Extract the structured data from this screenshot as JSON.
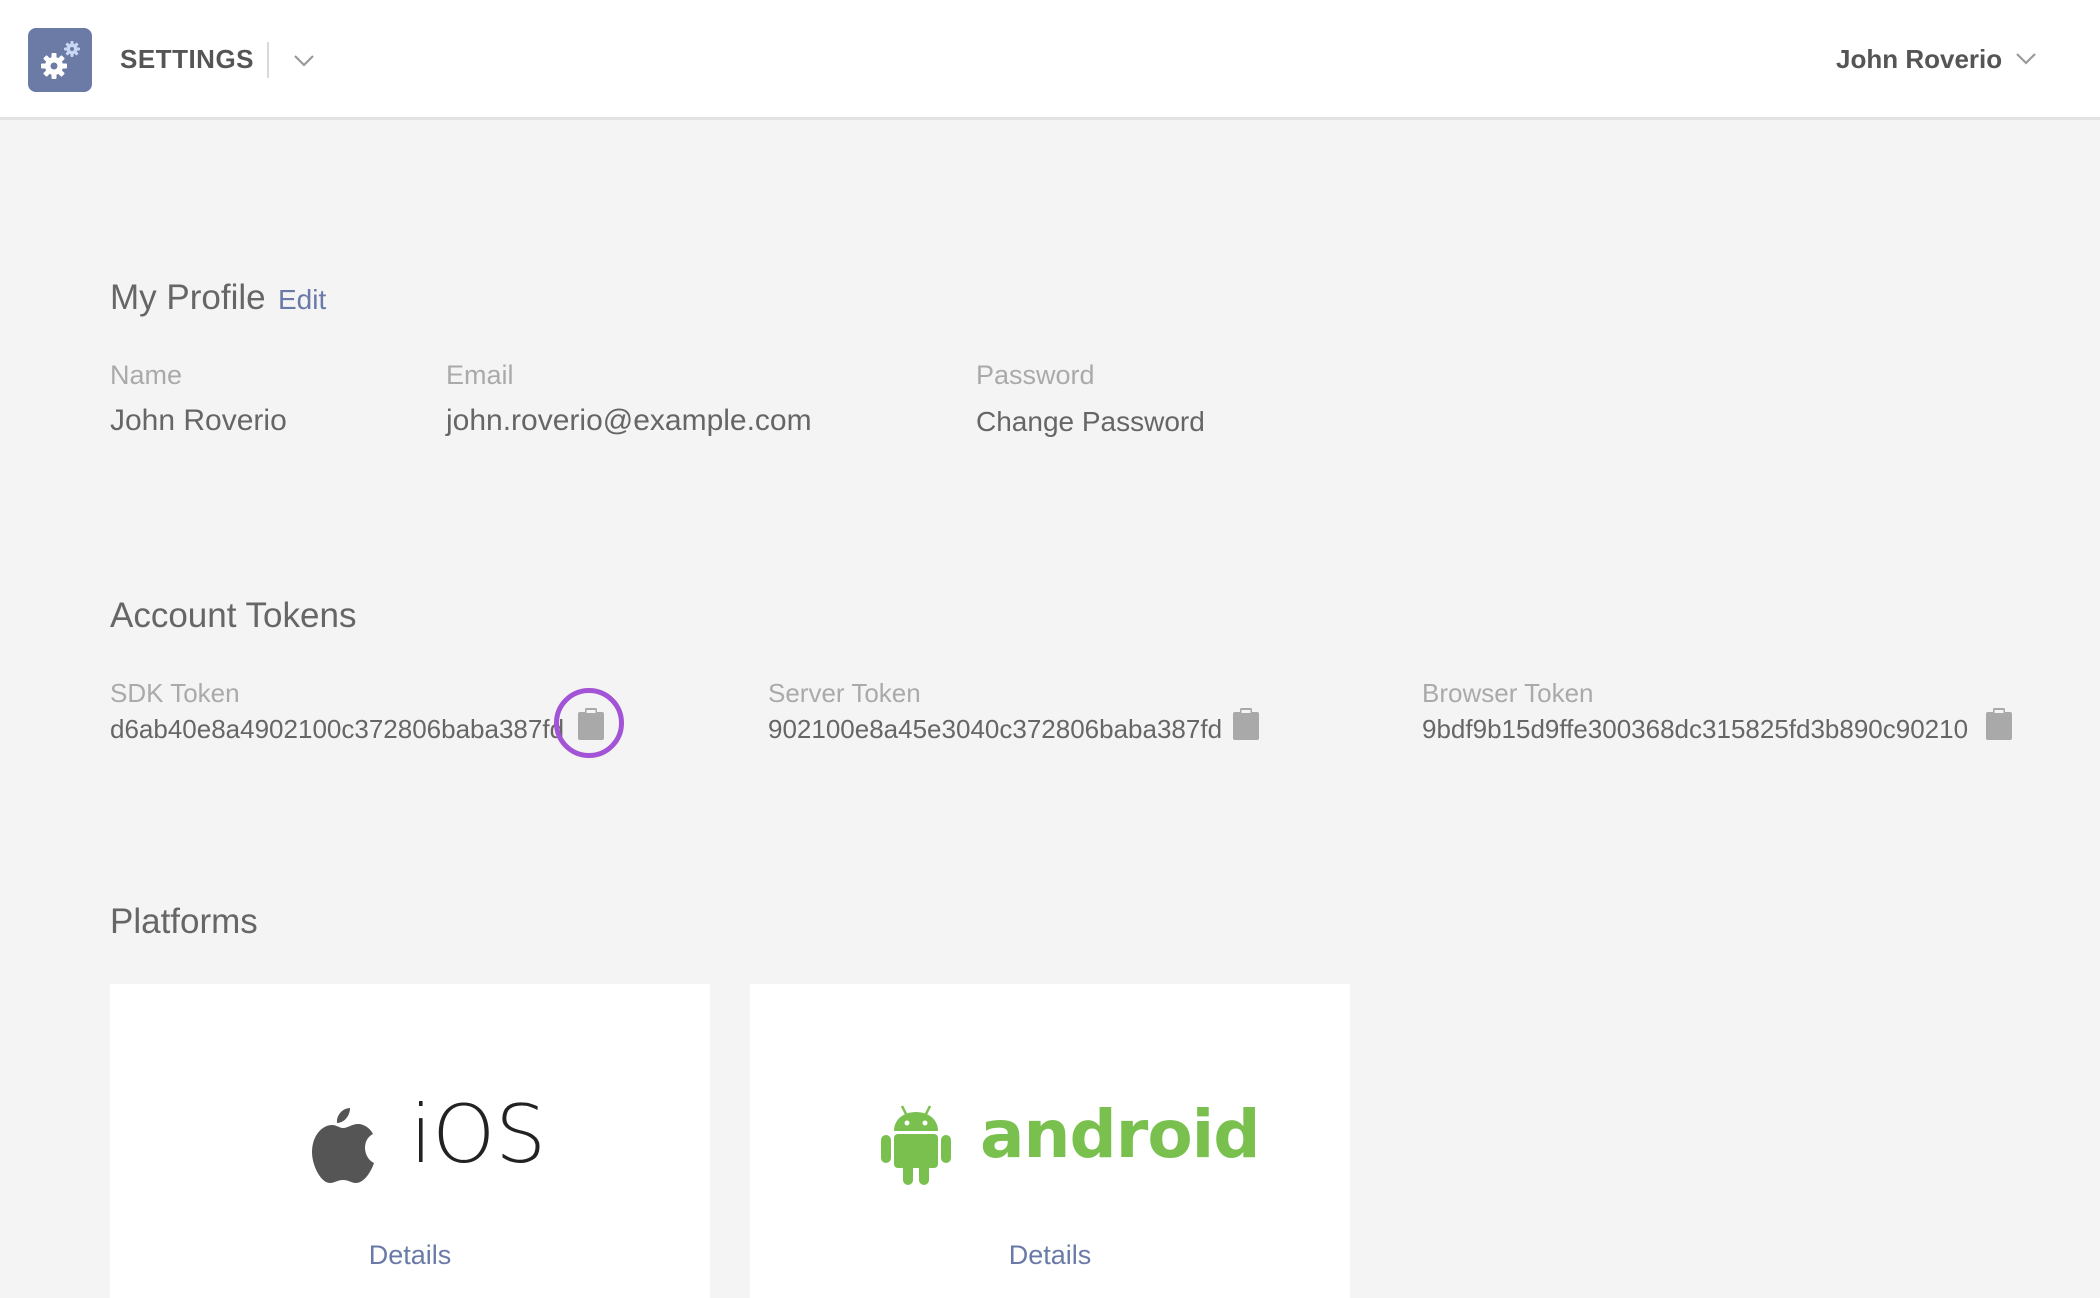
{
  "header": {
    "title": "SETTINGS",
    "user_name": "John Roverio"
  },
  "profile": {
    "title": "My Profile",
    "edit_label": "Edit",
    "name_label": "Name",
    "name_value": "John Roverio",
    "email_label": "Email",
    "email_value": "john.roverio@example.com",
    "password_label": "Password",
    "change_password_label": "Change Password"
  },
  "tokens": {
    "title": "Account Tokens",
    "items": [
      {
        "label": "SDK Token",
        "value": "d6ab40e8a4902100c372806baba387fd"
      },
      {
        "label": "Server Token",
        "value": "902100e8a45e3040c372806baba387fd"
      },
      {
        "label": "Browser Token",
        "value": "9bdf9b15d9ffe300368dc315825fd3b890c90210"
      }
    ]
  },
  "platforms": {
    "title": "Platforms",
    "items": [
      {
        "name": "iOS",
        "details_label": "Details"
      },
      {
        "name": "android",
        "details_label": "Details"
      }
    ]
  },
  "colors": {
    "accent_link": "#6a7aa8",
    "app_icon_bg": "#6b7ba6",
    "highlight": "#a253d6",
    "android_green": "#79c04f"
  },
  "icons": [
    "gear-icon",
    "chevron-down-icon",
    "clipboard-icon",
    "apple-icon",
    "android-robot-icon"
  ]
}
